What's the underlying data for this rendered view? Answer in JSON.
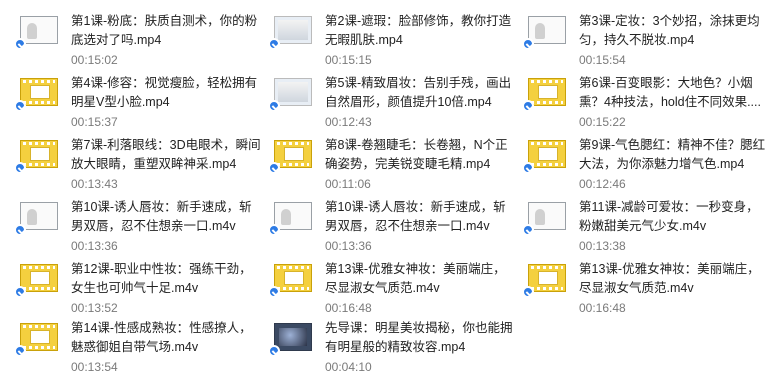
{
  "files": [
    {
      "name": "第1课-粉底：肤质自测术，你的粉底选对了吗.mp4",
      "duration": "00:15:02",
      "thumb": "blank-icon"
    },
    {
      "name": "第2课-遮瑕：脸部修饰，教你打造无暇肌肤.mp4",
      "duration": "00:15:15",
      "thumb": "photo-thumbnail"
    },
    {
      "name": "第3课-定妆：3个妙招，涂抹更均匀，持久不脱妆.mp4",
      "duration": "00:15:54",
      "thumb": "blank-icon"
    },
    {
      "name": "第4课-修容：视觉瘦脸，轻松拥有明星V型小脸.mp4",
      "duration": "00:15:37",
      "thumb": "video-file-icon"
    },
    {
      "name": "第5课-精致眉妆：告别手残，画出自然眉形，颜值提升10倍.mp4",
      "duration": "00:12:43",
      "thumb": "photo-thumbnail"
    },
    {
      "name": "第6课-百变眼影：大地色？小烟熏？4种技法，hold住不同效果....",
      "duration": "00:15:22",
      "thumb": "video-file-icon"
    },
    {
      "name": "第7课-利落眼线：3D电眼术，瞬间放大眼睛，重塑双眸神采.mp4",
      "duration": "00:13:43",
      "thumb": "video-file-icon"
    },
    {
      "name": "第8课-卷翘睫毛：长卷翘，N个正确姿势，完美锐变睫毛精.mp4",
      "duration": "00:11:06",
      "thumb": "video-file-icon"
    },
    {
      "name": "第9课-气色腮红：精神不佳？腮红大法，为你添魅力增气色.mp4",
      "duration": "00:12:46",
      "thumb": "video-file-icon"
    },
    {
      "name": "第10课-诱人唇妆：新手速成，斩男双唇，忍不住想亲一口.m4v",
      "duration": "00:13:36",
      "thumb": "blank-icon"
    },
    {
      "name": "第10课-诱人唇妆：新手速成，斩男双唇，忍不住想亲一口.m4v",
      "duration": "00:13:36",
      "thumb": "blank-icon"
    },
    {
      "name": "第11课-减龄可爱妆：一秒变身，粉嫩甜美元气少女.m4v",
      "duration": "00:13:38",
      "thumb": "blank-icon"
    },
    {
      "name": "第12课-职业中性妆：强练干劲，女生也可帅气十足.m4v",
      "duration": "00:13:52",
      "thumb": "video-file-icon"
    },
    {
      "name": "第13课-优雅女神妆：美丽端庄，尽显淑女气质范.m4v",
      "duration": "00:16:48",
      "thumb": "video-file-icon"
    },
    {
      "name": "第13课-优雅女神妆：美丽端庄，尽显淑女气质范.m4v",
      "duration": "00:16:48",
      "thumb": "video-file-icon"
    },
    {
      "name": "第14课-性感成熟妆：性感撩人，魅惑御姐自带气场.m4v",
      "duration": "00:13:54",
      "thumb": "video-file-icon"
    },
    {
      "name": "先导课：明星美妆揭秘，你也能拥有明星般的精致妆容.mp4",
      "duration": "00:04:10",
      "thumb": "dark-photo-thumbnail"
    }
  ]
}
